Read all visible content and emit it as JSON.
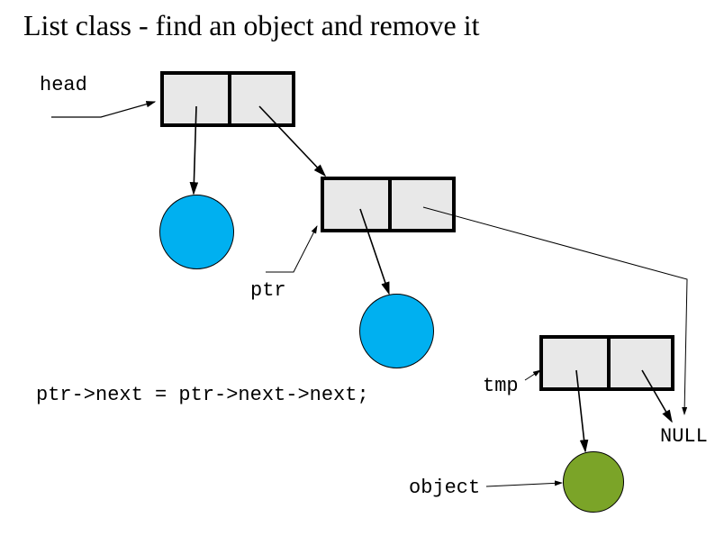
{
  "title": "List class - find an object and remove it",
  "labels": {
    "head": "head",
    "ptr": "ptr",
    "tmp": "tmp",
    "null": "NULL",
    "object": "object",
    "code": "ptr->next = ptr->next->next;"
  }
}
